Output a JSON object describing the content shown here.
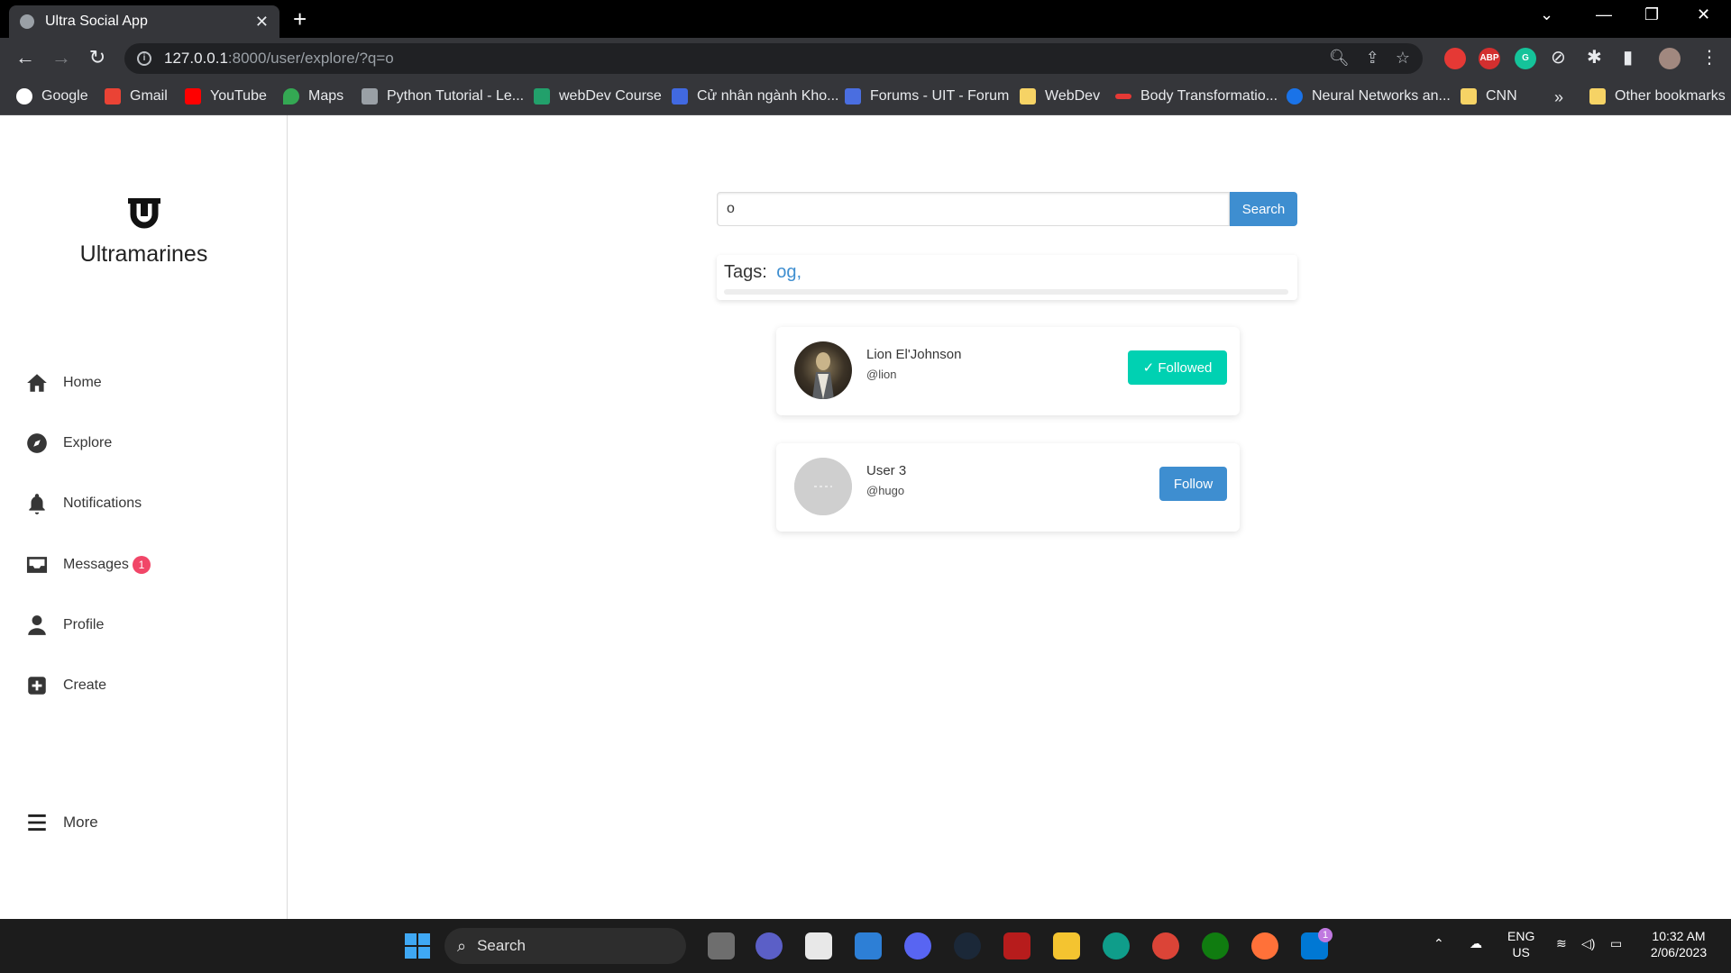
{
  "browser": {
    "tab_title": "Ultra Social App",
    "url_host": "127.0.0.1",
    "url_rest": ":8000/user/explore/?q=o",
    "bookmarks": [
      {
        "label": "Google",
        "color": "#ffffff"
      },
      {
        "label": "Gmail",
        "color": "#ea4335"
      },
      {
        "label": "YouTube",
        "color": "#ff0000"
      },
      {
        "label": "Maps",
        "color": "#34a853"
      },
      {
        "label": "Python Tutorial - Le...",
        "color": "#9aa0a6"
      },
      {
        "label": "webDev Course",
        "color": "#22a06b"
      },
      {
        "label": "Cử nhân ngành Kho...",
        "color": "#4169e1"
      },
      {
        "label": "Forums - UIT - Forum",
        "color": "#4a6ee0"
      },
      {
        "label": "WebDev",
        "color": "#f6d365"
      },
      {
        "label": "Body Transformatio...",
        "color": "#e53935"
      },
      {
        "label": "Neural Networks an...",
        "color": "#1a73e8"
      },
      {
        "label": "CNN",
        "color": "#f6d365"
      }
    ],
    "more_bookmarks": "»",
    "other_bookmarks": "Other bookmarks"
  },
  "sidebar": {
    "brand": "Ultramarines",
    "nav": [
      {
        "label": "Home",
        "icon": "home-icon"
      },
      {
        "label": "Explore",
        "icon": "compass-icon"
      },
      {
        "label": "Notifications",
        "icon": "bell-icon"
      },
      {
        "label": "Messages",
        "icon": "inbox-icon",
        "badge": "1"
      },
      {
        "label": "Profile",
        "icon": "user-icon"
      },
      {
        "label": "Create",
        "icon": "plus-square-icon"
      }
    ],
    "more": "More"
  },
  "explore": {
    "search_value": "o",
    "search_button": "Search",
    "tags_label": "Tags:",
    "tags": "og,",
    "users": [
      {
        "name": "Lion El'Johnson",
        "handle": "@lion",
        "button": "Followed",
        "followed": true
      },
      {
        "name": "User 3",
        "handle": "@hugo",
        "button": "Follow",
        "followed": false
      }
    ]
  },
  "taskbar": {
    "search": "Search",
    "lang": "ENG",
    "region": "US",
    "time": "10:32 AM",
    "date": "2/06/2023",
    "mail_badge": "1"
  },
  "colors": {
    "primary": "#3e8ed0",
    "success": "#00d1b2",
    "danger": "#f14668"
  }
}
